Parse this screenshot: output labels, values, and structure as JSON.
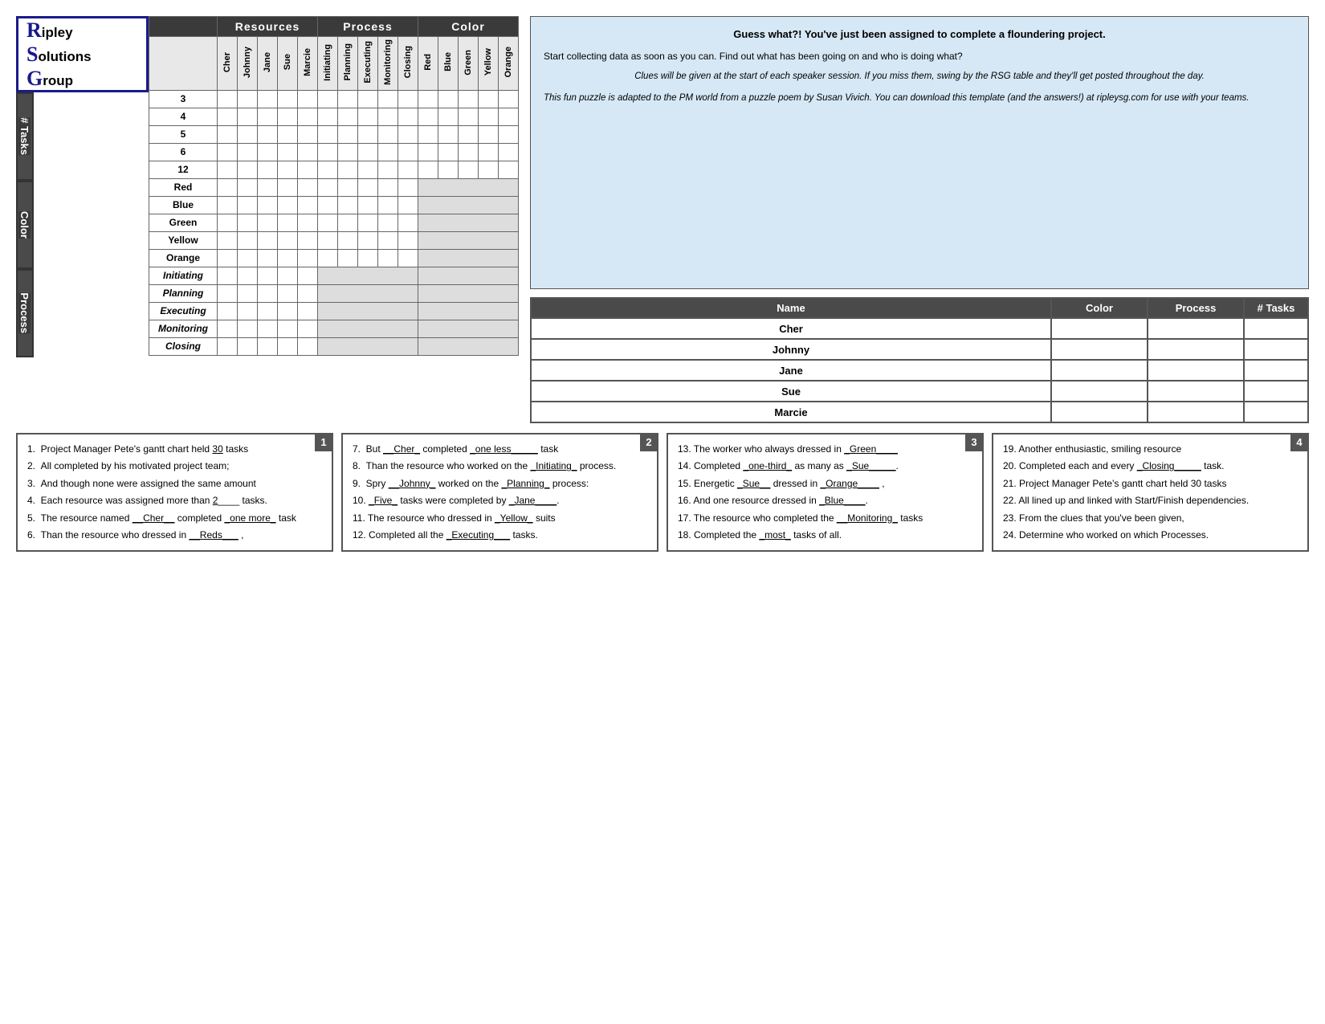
{
  "logo": {
    "line1_initial": "R",
    "line1_rest": "ipley",
    "line2_initial": "S",
    "line2_rest": "olutions",
    "line3_initial": "G",
    "line3_rest": "roup"
  },
  "headers": {
    "resources": "Resources",
    "process": "Process",
    "color": "Color"
  },
  "col_headers": {
    "resources": [
      "Cher",
      "Johnny",
      "Jane",
      "Sue",
      "Marcie"
    ],
    "process": [
      "Initiating",
      "Planning",
      "Executing",
      "Monitoring",
      "Closing"
    ],
    "color": [
      "Red",
      "Blue",
      "Green",
      "Yellow",
      "Orange"
    ]
  },
  "row_groups": {
    "tasks": {
      "label": "# Tasks",
      "rows": [
        "3",
        "4",
        "5",
        "6",
        "12"
      ]
    },
    "color": {
      "label": "Color",
      "rows": [
        "Red",
        "Blue",
        "Green",
        "Yellow",
        "Orange"
      ]
    },
    "process": {
      "label": "Process",
      "rows": [
        "Initiating",
        "Planning",
        "Executing",
        "Monitoring",
        "Closing"
      ]
    }
  },
  "summary_table": {
    "headers": [
      "Name",
      "Color",
      "Process",
      "# Tasks"
    ],
    "rows": [
      {
        "name": "Cher",
        "color": "",
        "process": "",
        "tasks": ""
      },
      {
        "name": "Johnny",
        "color": "",
        "process": "",
        "tasks": ""
      },
      {
        "name": "Jane",
        "color": "",
        "process": "",
        "tasks": ""
      },
      {
        "name": "Sue",
        "color": "",
        "process": "",
        "tasks": ""
      },
      {
        "name": "Marcie",
        "color": "",
        "process": "",
        "tasks": ""
      }
    ]
  },
  "info_box": {
    "headline": "Guess what?! You've just been assigned to complete a floundering project.",
    "body": "Start collecting data as soon as you can.  Find out what has been going on and who is doing what?",
    "italic": "Clues will be given at the start of each speaker session.  If you miss them, swing by the RSG table and they'll get posted throughout the day.",
    "credit": "This fun puzzle is adapted to the PM world from a puzzle poem by Susan Vivich.  You can download this template (and the answers!) at ripleysg.com for use with your teams."
  },
  "clues": {
    "box1": {
      "number": "1",
      "items": [
        "1.  Project Manager Pete's gantt chart held __30__ tasks",
        "2.  All completed by his motivated project team;",
        "3.  And though none were assigned the same amount",
        "4.  Each resource was assigned more than __2____ tasks.",
        "5.  The resource named __Cher__ completed _one more_ task",
        "6.  Than the resource who dressed in __Reds___ ,"
      ]
    },
    "box2": {
      "number": "2",
      "items": [
        "7.  But __Cher_ completed _one less_____ task",
        "8.  Than the resource who worked on the _Initiating_ process.",
        "9.  Spry __Johnny_ worked on the _Planning_ process:",
        "10. _Five_ tasks were completed by _Jane____.",
        "11. The resource who dressed in _Yellow_ suits",
        "12. Completed all the _Executing___ tasks."
      ]
    },
    "box3": {
      "number": "3",
      "items": [
        "13. The worker who always dressed in _Green____",
        "14. Completed _one-third_ as many as _Sue_____.",
        "15. Energetic _Sue__ dressed in _Orange____ ,",
        "16. And one resource dressed in _Blue____.",
        "17. The resource who completed the __Monitoring_ tasks",
        "18. Completed the _most_ tasks of all."
      ]
    },
    "box4": {
      "number": "4",
      "items": [
        "19. Another enthusiastic, smiling resource",
        "20. Completed each and every _Closing_____ task.",
        "21. Project Manager Pete's gantt chart held 30 tasks",
        "22. All lined up and linked with Start/Finish dependencies.",
        "23. From the clues that you've been given,",
        "24. Determine who worked on which Processes."
      ]
    }
  }
}
